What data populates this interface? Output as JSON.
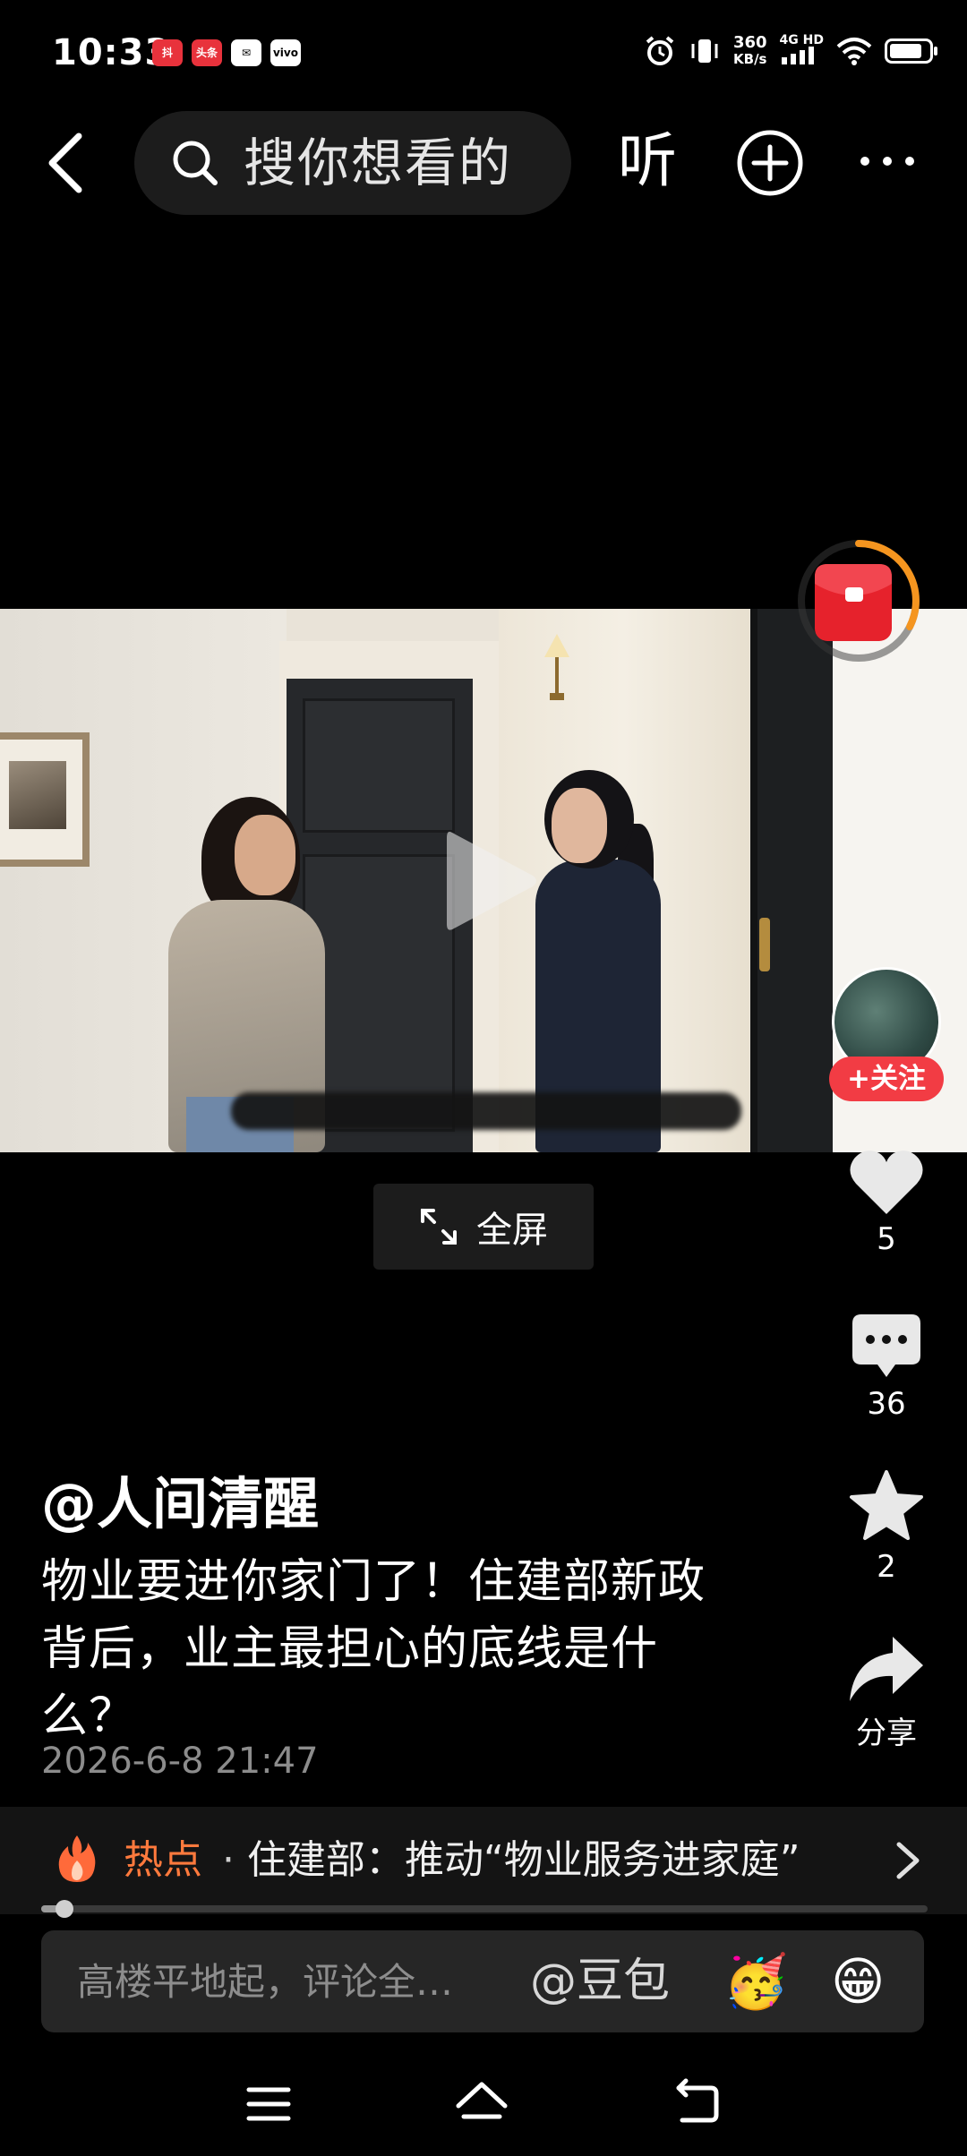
{
  "status_bar": {
    "time": "10:33",
    "apps": [
      "抖",
      "头条",
      "✉",
      "vivo"
    ],
    "net_speed_top": "360",
    "net_speed_bottom": "KB/s",
    "net_type": "4G HD",
    "battery_level": 0.85
  },
  "nav": {
    "search_placeholder": "搜你想看的",
    "listen_label": "听"
  },
  "video": {
    "progress": 0.026
  },
  "fullscreen": {
    "label": "全屏"
  },
  "creator": {
    "follow_label": "+关注"
  },
  "actions": {
    "likes": "5",
    "comments": "36",
    "favorites": "2",
    "share_label": "分享"
  },
  "post": {
    "author": "@人间清醒",
    "caption": "物业要进你家门了！住建部新政背后，业主最担心的底线是什么？",
    "date": "2026-6-8 21:47"
  },
  "hot": {
    "label": "热点",
    "separator": "·",
    "text": "住建部：推动“物业服务进家庭”"
  },
  "comment_bar": {
    "placeholder": "高楼平地起，评论全…",
    "mention": "@豆包",
    "emoji_1": "🥳",
    "emoji_2": "😁"
  },
  "colors": {
    "accent_red": "#f23c44",
    "hot_orange": "#ff7a3d",
    "background": "#000000"
  }
}
